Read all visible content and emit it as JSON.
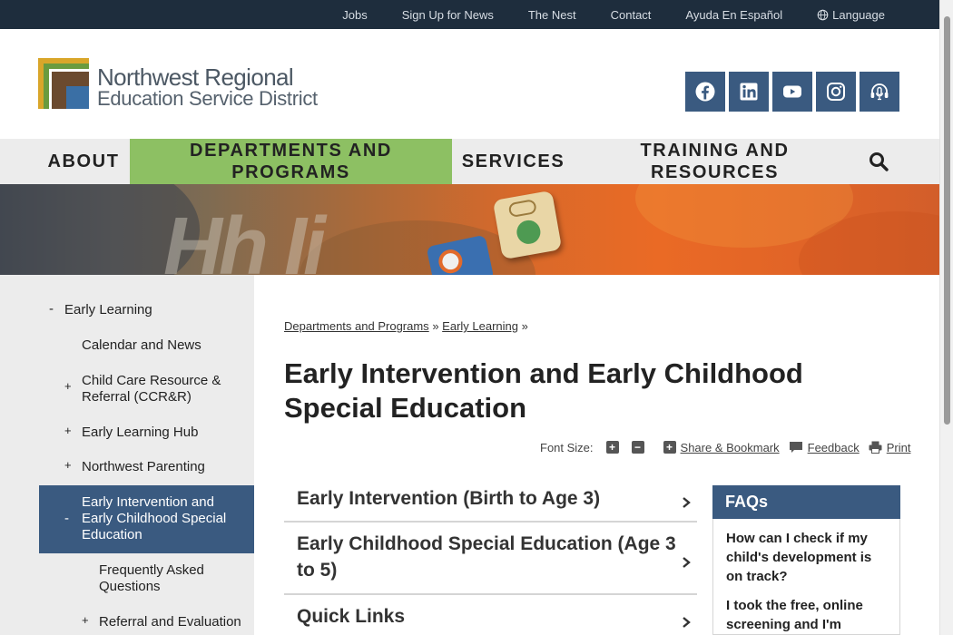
{
  "utility": {
    "links": [
      "Jobs",
      "Sign Up for News",
      "The Nest",
      "Contact",
      "Ayuda En Español"
    ],
    "language_label": "Language"
  },
  "logo": {
    "line1": "Northwest Regional",
    "line2": "Education Service District",
    "colors": [
      "#d9a62a",
      "#6a9b3e",
      "#6b4a2f",
      "#3a6fa5"
    ]
  },
  "socials": [
    "facebook-icon",
    "linkedin-icon",
    "youtube-icon",
    "instagram-icon",
    "podcast-icon"
  ],
  "nav": {
    "about": "ABOUT",
    "departments": "DEPARTMENTS AND PROGRAMS",
    "services": "SERVICES",
    "training": "TRAINING AND RESOURCES"
  },
  "hero": {
    "letters": "Hh  Ii"
  },
  "sidebar": {
    "items": [
      {
        "label": "Early Learning",
        "toggle": "-"
      },
      {
        "label": "Calendar and News",
        "toggle": ""
      },
      {
        "label": "Child Care Resource & Referral (CCR&R)",
        "toggle": "+"
      },
      {
        "label": "Early Learning Hub",
        "toggle": "+"
      },
      {
        "label": "Northwest Parenting",
        "toggle": "+"
      },
      {
        "label": "Early Intervention and Early Childhood Special Education",
        "toggle": "-"
      },
      {
        "label": "Frequently Asked Questions",
        "toggle": ""
      },
      {
        "label": "Referral and Evaluation",
        "toggle": "+"
      }
    ]
  },
  "breadcrumb": {
    "items": [
      "Departments and Programs",
      "Early Learning"
    ],
    "separator": "»"
  },
  "page_title": "Early Intervention and Early Childhood Special Education",
  "tools": {
    "font_size_label": "Font Size:",
    "increase_glyph": "+",
    "decrease_glyph": "−",
    "share": "Share & Bookmark",
    "feedback": "Feedback",
    "print": "Print"
  },
  "accordion": [
    "Early Intervention (Birth to Age 3)",
    "Early Childhood Special Education (Age 3 to 5)",
    "Quick Links"
  ],
  "faqs": {
    "title": "FAQs",
    "questions": [
      "How can I check if my child's development is on track?",
      "I took the free, online screening and I'm"
    ]
  },
  "colors": {
    "nav_active": "#8dc063",
    "brand_blue": "#3a5a80",
    "utility_bg": "#1e2d3d"
  }
}
